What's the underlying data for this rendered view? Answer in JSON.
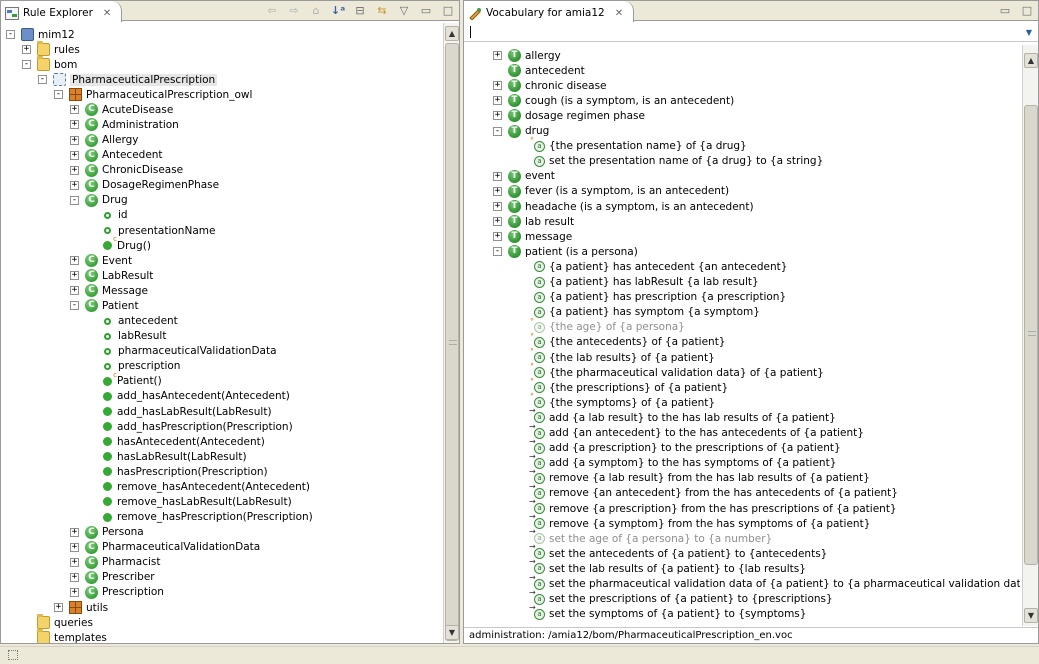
{
  "left_panel": {
    "tab_title": "Rule Explorer",
    "tab_icon": "rule-explorer-icon",
    "toolbar_icons": [
      "back-arrow-icon",
      "forward-arrow-icon",
      "home-icon",
      "sort-icon",
      "collapse-all-icon",
      "link-editor-icon",
      "view-menu-icon"
    ],
    "tree": [
      {
        "label": "mim12",
        "icon": "project",
        "exp": "-"
      },
      {
        "label": "rules",
        "icon": "folder",
        "exp": "+"
      },
      {
        "label": "bom",
        "icon": "folder",
        "exp": "-"
      },
      {
        "label": "PharmaceuticalPrescription",
        "icon": "bom",
        "exp": "-",
        "selected": true
      },
      {
        "label": "PharmaceuticalPrescription_owl",
        "icon": "package",
        "exp": "-"
      },
      {
        "label": "AcuteDisease",
        "icon": "class",
        "exp": "+"
      },
      {
        "label": "Administration",
        "icon": "class",
        "exp": "+"
      },
      {
        "label": "Allergy",
        "icon": "class",
        "exp": "+"
      },
      {
        "label": "Antecedent",
        "icon": "class",
        "exp": "+"
      },
      {
        "label": "ChronicDisease",
        "icon": "class",
        "exp": "+"
      },
      {
        "label": "DosageRegimenPhase",
        "icon": "class",
        "exp": "+"
      },
      {
        "label": "Drug",
        "icon": "class",
        "exp": "-"
      },
      {
        "label": "id",
        "icon": "attr"
      },
      {
        "label": "presentationName",
        "icon": "attr"
      },
      {
        "label": "Drug()",
        "icon": "ctor"
      },
      {
        "label": "Event",
        "icon": "class",
        "exp": "+"
      },
      {
        "label": "LabResult",
        "icon": "class",
        "exp": "+"
      },
      {
        "label": "Message",
        "icon": "class",
        "exp": "+"
      },
      {
        "label": "Patient",
        "icon": "class",
        "exp": "-"
      },
      {
        "label": "antecedent",
        "icon": "attr"
      },
      {
        "label": "labResult",
        "icon": "attr"
      },
      {
        "label": "pharmaceuticalValidationData",
        "icon": "attr"
      },
      {
        "label": "prescription",
        "icon": "attr"
      },
      {
        "label": "Patient()",
        "icon": "ctor"
      },
      {
        "label": "add_hasAntecedent(Antecedent)",
        "icon": "method"
      },
      {
        "label": "add_hasLabResult(LabResult)",
        "icon": "method"
      },
      {
        "label": "add_hasPrescription(Prescription)",
        "icon": "method"
      },
      {
        "label": "hasAntecedent(Antecedent)",
        "icon": "method"
      },
      {
        "label": "hasLabResult(LabResult)",
        "icon": "method"
      },
      {
        "label": "hasPrescription(Prescription)",
        "icon": "method"
      },
      {
        "label": "remove_hasAntecedent(Antecedent)",
        "icon": "method"
      },
      {
        "label": "remove_hasLabResult(LabResult)",
        "icon": "method"
      },
      {
        "label": "remove_hasPrescription(Prescription)",
        "icon": "method"
      },
      {
        "label": "Persona",
        "icon": "class",
        "exp": "+"
      },
      {
        "label": "PharmaceuticalValidationData",
        "icon": "class",
        "exp": "+"
      },
      {
        "label": "Pharmacist",
        "icon": "class",
        "exp": "+"
      },
      {
        "label": "Prescriber",
        "icon": "class",
        "exp": "+"
      },
      {
        "label": "Prescription",
        "icon": "class",
        "exp": "+"
      },
      {
        "label": "utils",
        "icon": "package",
        "exp": "+"
      },
      {
        "label": "queries",
        "icon": "folder"
      },
      {
        "label": "templates",
        "icon": "folder"
      }
    ]
  },
  "right_panel": {
    "tab_title": "Vocabulary for amia12",
    "tab_icon": "vocabulary-icon",
    "search_value": "",
    "status_text": "administration: /amia12/bom/PharmaceuticalPrescription_en.voc",
    "tree": [
      {
        "label": "allergy",
        "icon": "term",
        "exp": "+"
      },
      {
        "label": "antecedent",
        "icon": "term"
      },
      {
        "label": "chronic disease",
        "icon": "term",
        "exp": "+"
      },
      {
        "label": "cough (is a symptom, is an antecedent)",
        "icon": "term",
        "exp": "+"
      },
      {
        "label": "dosage regimen phase",
        "icon": "term",
        "exp": "+"
      },
      {
        "label": "drug",
        "icon": "term",
        "exp": "-"
      },
      {
        "label": "{the presentation name} of {a drug}",
        "icon": "nav-static"
      },
      {
        "label": "set the presentation name of {a drug} to {a string}",
        "icon": "nav"
      },
      {
        "label": "event",
        "icon": "term",
        "exp": "+"
      },
      {
        "label": "fever (is a symptom, is an antecedent)",
        "icon": "term",
        "exp": "+"
      },
      {
        "label": "headache (is a symptom, is an antecedent)",
        "icon": "term",
        "exp": "+"
      },
      {
        "label": "lab result",
        "icon": "term",
        "exp": "+"
      },
      {
        "label": "message",
        "icon": "term",
        "exp": "+"
      },
      {
        "label": "patient (is a persona)",
        "icon": "term",
        "exp": "-"
      },
      {
        "label": "{a patient} has antecedent {an antecedent}",
        "icon": "nav"
      },
      {
        "label": "{a patient} has labResult {a lab result}",
        "icon": "nav"
      },
      {
        "label": "{a patient} has prescription {a prescription}",
        "icon": "nav"
      },
      {
        "label": "{a patient} has symptom {a symptom}",
        "icon": "nav"
      },
      {
        "label": "{the age} of {a persona}",
        "icon": "nav-static",
        "gray": true
      },
      {
        "label": "{the antecedents} of {a patient}",
        "icon": "nav-static"
      },
      {
        "label": "{the lab results} of {a patient}",
        "icon": "nav-static"
      },
      {
        "label": "{the pharmaceutical validation data} of {a patient}",
        "icon": "nav-static"
      },
      {
        "label": "{the prescriptions} of {a patient}",
        "icon": "nav-static"
      },
      {
        "label": "{the symptoms} of {a patient}",
        "icon": "nav-static"
      },
      {
        "label": "add {a lab result} to the has lab results of {a patient}",
        "icon": "nav-arrow"
      },
      {
        "label": "add {an antecedent} to the has antecedents of {a patient}",
        "icon": "nav-arrow"
      },
      {
        "label": "add {a prescription} to the prescriptions of {a patient}",
        "icon": "nav-arrow"
      },
      {
        "label": "add {a symptom} to the has symptoms of {a patient}",
        "icon": "nav-arrow"
      },
      {
        "label": "remove {a lab result} from the has lab results of {a patient}",
        "icon": "nav-arrow"
      },
      {
        "label": "remove {an antecedent} from the has antecedents of {a patient}",
        "icon": "nav-arrow"
      },
      {
        "label": "remove {a prescription} from the has prescriptions of {a patient}",
        "icon": "nav-arrow"
      },
      {
        "label": "remove {a symptom} from the has symptoms of {a patient}",
        "icon": "nav-arrow"
      },
      {
        "label": "set the age of {a persona} to {a number}",
        "icon": "nav-arrow",
        "gray": true
      },
      {
        "label": "set the antecedents of {a patient} to {antecedents}",
        "icon": "nav-arrow"
      },
      {
        "label": "set the lab results of {a patient} to {lab results}",
        "icon": "nav-arrow"
      },
      {
        "label": "set the pharmaceutical validation data of {a patient} to {a pharmaceutical validation data}",
        "icon": "nav-arrow"
      },
      {
        "label": "set the prescriptions of {a patient} to {prescriptions}",
        "icon": "nav-arrow"
      },
      {
        "label": "set the symptoms of {a patient} to {symptoms}",
        "icon": "nav-arrow"
      }
    ]
  },
  "colors": {
    "chrome": "#ece9d8",
    "class_icon": "#1b8a1b",
    "gray_text": "#8e8e8e"
  }
}
